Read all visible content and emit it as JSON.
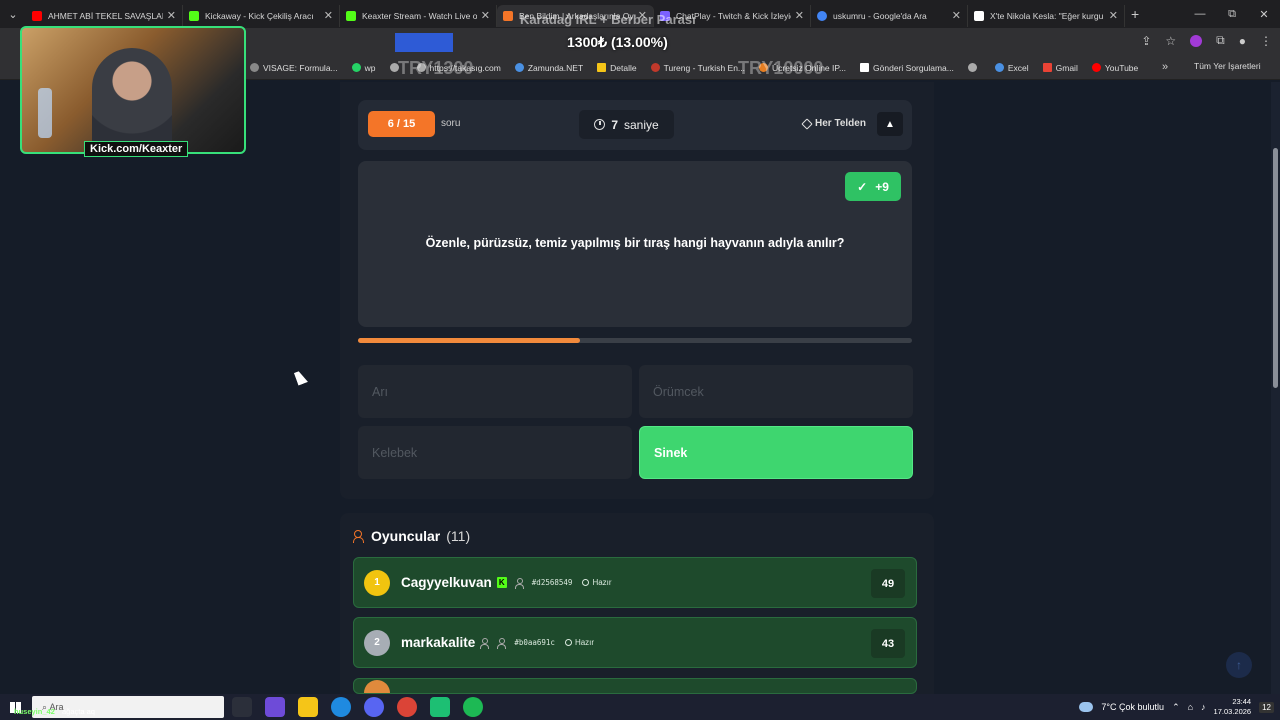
{
  "browser": {
    "tabs": [
      {
        "title": "AHMET ABİ TEKEL SAVAŞLARI -",
        "color": "#ff0000"
      },
      {
        "title": "Kickaway - Kick Çekiliş Aracı",
        "color": "#53fc18"
      },
      {
        "title": "Keaxter Stream - Watch Live on",
        "color": "#53fc18"
      },
      {
        "title": "Ben Bildim | Arkadaşlarınla Oyn",
        "color": "#f47528"
      },
      {
        "title": "ChatPlay - Twitch & Kick İzleyic",
        "color": "#7b61ff"
      },
      {
        "title": "uskumru - Google'da Ara",
        "color": "#4285f4"
      },
      {
        "title": "X'te Nikola Kesla: \"Eğer kurgu",
        "color": "#ffffff"
      }
    ],
    "active_tab_index": 3,
    "new_tab": "+",
    "window_controls": [
      "—",
      "⧉",
      "✕"
    ],
    "bookmarks": [
      {
        "label": "VISAGE: Formula...",
        "color": "#888888"
      },
      {
        "label": "wp",
        "color": "#25d366"
      },
      {
        "label": "",
        "color": "#aaaaaa"
      },
      {
        "label": "https://takasıg.com",
        "color": "#aaaaaa"
      },
      {
        "label": "Zamunda.NET",
        "color": "#4a90e2"
      },
      {
        "label": "Detalle",
        "color": "#f5c518"
      },
      {
        "label": "Tureng - Turkish En...",
        "color": "#c0392b"
      },
      {
        "label": "Ücretsiz Online IP...",
        "color": "#e67e22"
      },
      {
        "label": "Gönderi Sorgulama...",
        "color": "#ffffff"
      },
      {
        "label": "",
        "color": "#aaaaaa"
      },
      {
        "label": "Excel",
        "color": "#4a90e2"
      },
      {
        "label": "Gmail",
        "color": "#ea4335"
      },
      {
        "label": "YouTube",
        "color": "#ff0000"
      }
    ],
    "bookmarks_more": "»",
    "all_bookmarks": "Tüm Yer İşaretleri"
  },
  "stream_overlay": {
    "title": "Karadağ IRL + Berber Parası",
    "progress_text": "1300₺ (13.00%)",
    "ghost_left": "TRY1300",
    "ghost_right": "TRY10000",
    "webcam_label": "Kick.com/Keaxter"
  },
  "game": {
    "question_counter": "6 / 15",
    "question_word": "soru",
    "timer_value": "7",
    "timer_unit": "saniye",
    "category": "Her Telden",
    "alert_icon": "▲",
    "points_badge": "+9",
    "question": "Özenle, pürüzsüz, temiz yapılmış bir tıraş hangi hayvanın adıyla anılır?",
    "progress_fraction": 0.4,
    "answers": [
      {
        "label": "Arı",
        "state": "dimmed"
      },
      {
        "label": "Örümcek",
        "state": "dimmed"
      },
      {
        "label": "Kelebek",
        "state": "dimmed"
      },
      {
        "label": "Sinek",
        "state": "correct"
      }
    ]
  },
  "players": {
    "title": "Oyuncular",
    "count": "(11)",
    "list": [
      {
        "rank": "1",
        "name": "Cagyyelkuvan",
        "kick": "K",
        "id": "#d2568549",
        "status": "Hazır",
        "score": "49",
        "rank_color": "#f1c40f"
      },
      {
        "rank": "2",
        "name": "markakalite",
        "kick": "",
        "id": "#b0aa691c",
        "status": "Hazır",
        "score": "43",
        "rank_color": "#a7adb5"
      }
    ]
  },
  "taskbar": {
    "search_placeholder": "Ara",
    "chat_user": "huseyin_42",
    "chat_message": "ağaçta aq",
    "weather": "7°C  Çok bulutlu",
    "time": "23:44",
    "date": "17.03.2026",
    "notifications": "12"
  }
}
